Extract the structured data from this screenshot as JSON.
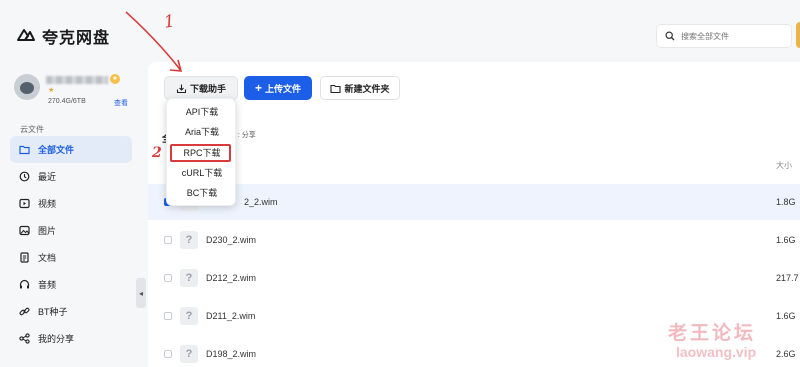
{
  "app": {
    "name": "夸克网盘"
  },
  "user": {
    "storage": "270.4G/6TB",
    "view_label": "查看"
  },
  "sidebar": {
    "section_label": "云文件",
    "items": [
      {
        "label": "全部文件",
        "icon": "folder-icon",
        "active": true
      },
      {
        "label": "最近",
        "icon": "clock-icon"
      },
      {
        "label": "视频",
        "icon": "video-icon"
      },
      {
        "label": "图片",
        "icon": "image-icon"
      },
      {
        "label": "文档",
        "icon": "document-icon"
      },
      {
        "label": "音频",
        "icon": "headphones-icon"
      },
      {
        "label": "BT种子",
        "icon": "link-icon"
      },
      {
        "label": "我的分享",
        "icon": "share-icon"
      }
    ]
  },
  "search": {
    "placeholder": "搜索全部文件"
  },
  "toolbar": {
    "download_helper": "下载助手",
    "upload": "上传文件",
    "new_folder": "新建文件夹"
  },
  "download_menu": {
    "items": [
      "API下载",
      "Aria下载",
      "RPC下载",
      "cURL下载",
      "BC下载"
    ],
    "highlighted": "RPC下载"
  },
  "content": {
    "crumb_fragment": "全",
    "share_fragment": "1 : 分享",
    "size_header": "大小"
  },
  "files": [
    {
      "name": "2_2.wim",
      "size": "1.8G",
      "selected": true
    },
    {
      "name": "D230_2.wim",
      "size": "1.6G"
    },
    {
      "name": "D212_2.wim",
      "size": "217.7"
    },
    {
      "name": "D211_2.wim",
      "size": "1.6G"
    },
    {
      "name": "D198_2.wim",
      "size": "2.6G"
    }
  ],
  "annotations": {
    "step1": "1",
    "step2": "2",
    "color": "#d83b3b"
  },
  "watermark": {
    "cn": "老王论坛",
    "en": "laowang.vip"
  },
  "colors": {
    "accent": "#1c5ee8",
    "annotation_red": "#d83b3b"
  }
}
